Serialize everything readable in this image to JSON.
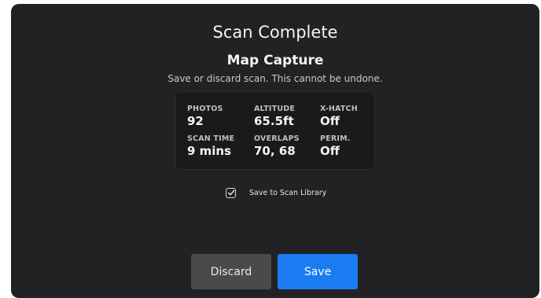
{
  "dialog": {
    "title": "Scan Complete",
    "subtitle": "Map Capture",
    "description": "Save or discard scan. This cannot be undone."
  },
  "stats": [
    {
      "label": "PHOTOS",
      "value": "92"
    },
    {
      "label": "ALTITUDE",
      "value": "65.5ft"
    },
    {
      "label": "X-HATCH",
      "value": "Off"
    },
    {
      "label": "SCAN TIME",
      "value": "9 mins"
    },
    {
      "label": "OVERLAPS",
      "value": "70, 68"
    },
    {
      "label": "PERIM.",
      "value": "Off"
    }
  ],
  "save_to_library": {
    "label": "Save to Scan Library",
    "checked": true,
    "icon": "checkmark-icon"
  },
  "buttons": {
    "discard_label": "Discard",
    "save_label": "Save"
  },
  "colors": {
    "background": "#222224",
    "card": "#1a1a1b",
    "discard_button": "#4a4a4c",
    "save_button": "#1a7cf0",
    "text": "#f4f4f4"
  }
}
